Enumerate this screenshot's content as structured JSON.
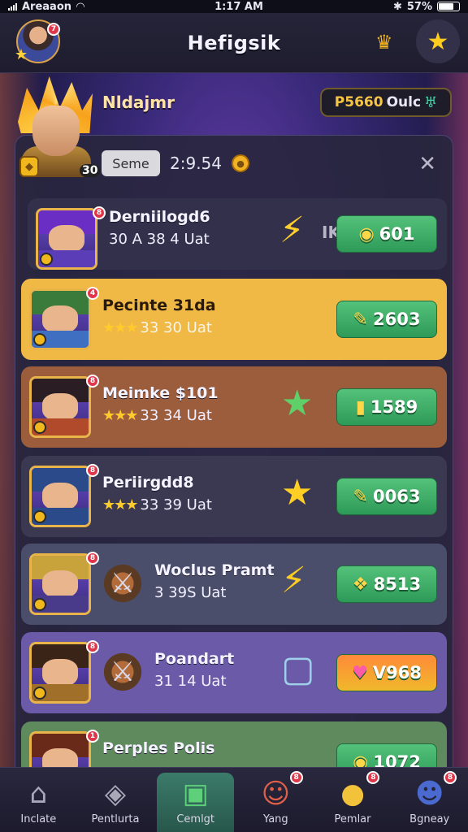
{
  "status_bar": {
    "carrier": "Areaaon",
    "time": "1:17 AM",
    "battery": "57%"
  },
  "header": {
    "title": "Hefigsik",
    "avatar_badge": "7"
  },
  "player": {
    "name": "Nldajmr",
    "level": "30",
    "currency_amount": "P5660",
    "currency_unit": "Oulc"
  },
  "filter": {
    "chip_label": "Seme",
    "timer": "2:9.54"
  },
  "items": [
    {
      "name": "Derniilogd6",
      "stats": "30 A   38 4 Uat",
      "stars": "",
      "price": "601",
      "extra_label": "IK",
      "badge": "8",
      "bg": "#32304a",
      "portrait_hair": "#6b2ec4",
      "portrait_body": "#5b3db8"
    },
    {
      "name": "Pecinte 31da",
      "stats": "33 30 Uat",
      "stars": "★★★",
      "price": "2603",
      "extra_label": "",
      "badge": "4",
      "bg": "#f0b845",
      "portrait_hair": "#3a7a3a",
      "portrait_body": "#3f6fc0"
    },
    {
      "name": "Meimke $101",
      "stats": "33 34 Uat",
      "stars": "★★★",
      "price": "1589",
      "extra_label": "",
      "badge": "8",
      "bg": "#9c5d3c",
      "portrait_hair": "#2a1e24",
      "portrait_body": "#b04a2a"
    },
    {
      "name": "Periirgdd8",
      "stats": "33 39 Uat",
      "stars": "★★★",
      "price": "0063",
      "extra_label": "",
      "badge": "8",
      "bg": "#3b3852",
      "portrait_hair": "#2a4a8a",
      "portrait_body": "#2a4a8a"
    },
    {
      "name": "Woclus Pramt",
      "stats": "3 39S Uat",
      "stars": "",
      "price": "8513",
      "extra_label": "",
      "badge": "8",
      "bg": "#4a4e6a",
      "portrait_hair": "#c8a23a",
      "portrait_body": "#4a3a8a"
    },
    {
      "name": "Poandart",
      "stats": "31 14 Uat",
      "stars": "",
      "price": "V968",
      "extra_label": "",
      "badge": "8",
      "bg": "#6a5aa8",
      "portrait_hair": "#3a2418",
      "portrait_body": "#a0702a"
    },
    {
      "name": "Perples Polis",
      "stats": "",
      "stars": "",
      "price": "1072",
      "extra_label": "",
      "badge": "1",
      "bg": "#5e8a5e",
      "portrait_hair": "#6a2a1a",
      "portrait_body": "#3a3a8a"
    }
  ],
  "nav": [
    {
      "label": "Inclate",
      "icon": "home-icon",
      "active": false,
      "badge": ""
    },
    {
      "label": "Pentlurta",
      "icon": "gem-frame-icon",
      "active": false,
      "badge": ""
    },
    {
      "label": "Cemlgt",
      "icon": "chest-icon",
      "active": true,
      "badge": ""
    },
    {
      "label": "Yang",
      "icon": "hero-icon",
      "active": false,
      "badge": "8"
    },
    {
      "label": "Pemlar",
      "icon": "coin-pile-icon",
      "active": false,
      "badge": "8"
    },
    {
      "label": "Bgneay",
      "icon": "profile-icon",
      "active": false,
      "badge": "8"
    }
  ]
}
